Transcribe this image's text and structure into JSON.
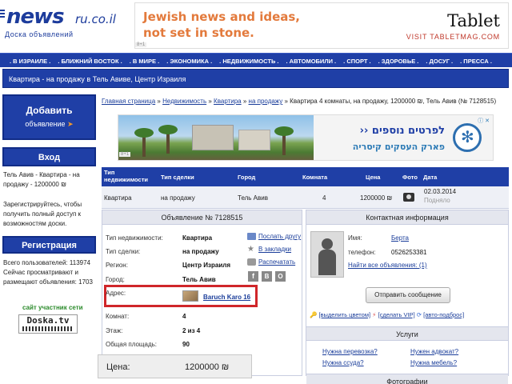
{
  "header": {
    "logo_main": "news",
    "logo_tld": "ru.co.il",
    "logo_sub": "Доска объявлений",
    "banner": {
      "line1": "Jewish news and ideas,",
      "line2": "not set in stone.",
      "brand": "Tablet",
      "visit": "VISIT TABLETMAG.COM",
      "badge": "8+1"
    }
  },
  "nav": {
    "items": [
      ". В ИЗРАИЛЕ .",
      ". БЛИЖНИЙ ВОСТОК .",
      ". В МИРЕ .",
      ". ЭКОНОМИКА .",
      ". НЕДВИЖИМОСТЬ .",
      ". АВТОМОБИЛИ .",
      ". СПОРТ .",
      ". ЗДОРОВЬЕ .",
      ". ДОСУГ .",
      ". ПРЕССА ."
    ]
  },
  "title_bar": "Квартира - на продажу в Тель Авиве, Центр Израиля",
  "sidebar": {
    "add_line1": "Добавить",
    "add_line2": "объявление",
    "add_arrow": "➤",
    "login_label": "Вход",
    "ad_text": "Тель Авив - Квартира - на продажу - 1200000 ₪",
    "note": "Зарегистрируйтесь, чтобы получить полный доступ к возможностям доски.",
    "register_label": "Регистрация",
    "users_stat": "Всего пользователей: 113974 Сейчас просматривают и размещают объявления: 1703",
    "members_label": "сайт участник сети",
    "doska_label": "Doska.tv"
  },
  "breadcrumb": {
    "links": [
      "Главная страница",
      "Недвижимость",
      "Квартира",
      "на продажу"
    ],
    "current": "Квартира 4 комнаты, на продажу, 1200000 ₪, Тель Авив (№ 7128515)",
    "separator": "»"
  },
  "content_ad": {
    "line1": "לפרטים נוספים ‹‹",
    "line2": "פארק העסקים קיסריה",
    "badge": "8+1",
    "info": "ⓘ ✕"
  },
  "listing": {
    "columns": [
      "Тип недвижимости",
      "Тип сделки",
      "Город",
      "Комната",
      "Цена",
      "Фото",
      "Дата"
    ],
    "row": {
      "type": "Квартира",
      "deal": "на продажу",
      "city": "Тель Авив",
      "rooms": "4",
      "price": "1200000 ₪",
      "date": "02.03.2014",
      "status": "Подняло"
    }
  },
  "ad_panel": {
    "title": "Объявление № 7128515",
    "fields": [
      {
        "label": "Тип недвижимости:",
        "value": "Квартира"
      },
      {
        "label": "Тип сделки:",
        "value": "на продажу"
      },
      {
        "label": "Регион:",
        "value": "Центр Израиля"
      },
      {
        "label": "Город:",
        "value": "Тель Авив"
      },
      {
        "label": "Адрес:",
        "value": "Baruch Karo 16"
      },
      {
        "label": "Комнат:",
        "value": "4"
      },
      {
        "label": "Этаж:",
        "value": "2 из 4"
      },
      {
        "label": "Общая площадь:",
        "value": "90"
      }
    ],
    "actions": {
      "send_friend": "Послать другу",
      "bookmark": "В закладки",
      "print": "Распечатать"
    },
    "social": [
      "f",
      "В",
      "О"
    ],
    "price_label": "Цена:",
    "price_value": "1200000 ₪"
  },
  "contact": {
    "title": "Контактная информация",
    "name_label": "Имя:",
    "name_value": "Берта",
    "phone_label": "телефон:",
    "phone_value": "0526253381",
    "all_ads": "Найти все объявления: (1)",
    "send_button": "Отправить сообщение",
    "promo": [
      "[выделить цветом]",
      "[сделать VIP]",
      "[авто-подброс]"
    ],
    "services_title": "Услуги",
    "services": [
      "Нужна перевозка?",
      "Нужен адвокат?",
      "Нужна ссуда?",
      "Нужна мебель?"
    ],
    "photos_title": "Фотографии"
  },
  "colors": {
    "brand_blue": "#1f3fa6",
    "accent_orange": "#f39a2b",
    "highlight_red": "#d0262a"
  }
}
